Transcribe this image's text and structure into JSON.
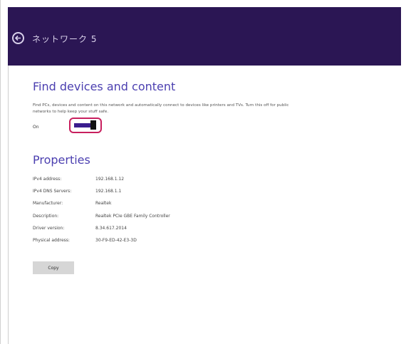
{
  "header": {
    "back_icon": "back-arrow-icon",
    "network_name": "ネットワーク 5",
    "background": "#2b1654"
  },
  "find_devices": {
    "title": "Find devices and content",
    "description": "Find PCs, devices and content on this network and automatically connect to devices like printers and TVs. Turn this off for public networks to help keep your stuff safe.",
    "toggle_label": "On",
    "toggle_on": true,
    "accent": "#4b3fb0",
    "highlight_color": "#c81f5e"
  },
  "properties": {
    "title": "Properties",
    "rows": [
      {
        "label": "IPv4 address:",
        "value": "192.168.1.12"
      },
      {
        "label": "IPv4 DNS Servers:",
        "value": "192.168.1.1"
      },
      {
        "label": "Manufacturer:",
        "value": "Realtek"
      },
      {
        "label": "Description:",
        "value": "Realtek PCIe GBE Family Controller"
      },
      {
        "label": "Driver version:",
        "value": "8.34.617.2014"
      },
      {
        "label": "Physical address:",
        "value": "30-F9-ED-42-E3-3D"
      }
    ],
    "copy_label": "Copy"
  }
}
